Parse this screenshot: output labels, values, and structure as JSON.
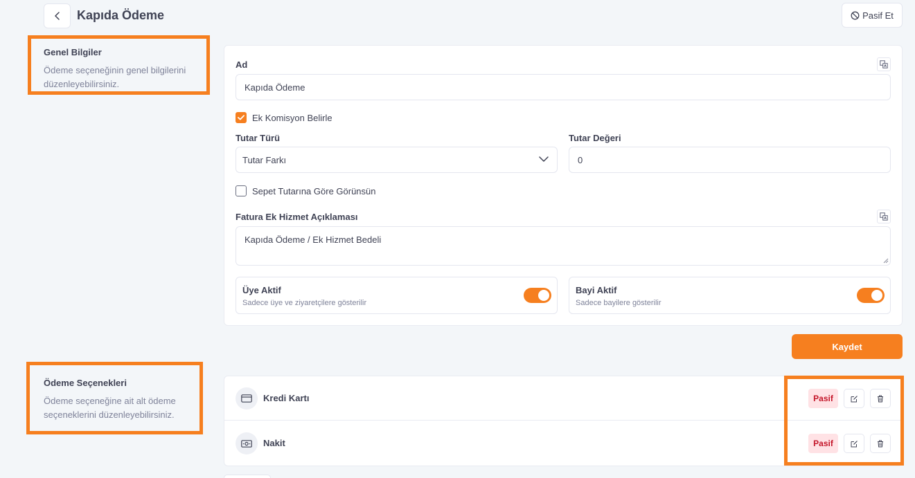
{
  "header": {
    "title": "Kapıda Ödeme",
    "pasif_et_label": "Pasif Et"
  },
  "general_section": {
    "title": "Genel Bilgiler",
    "description": "Ödeme seçeneğinin genel bilgilerini düzenleyebilirsiniz."
  },
  "form": {
    "ad_label": "Ad",
    "ad_value": "Kapıda Ödeme",
    "ek_komisyon_label": "Ek Komisyon Belirle",
    "ek_komisyon_checked": true,
    "tutar_turu_label": "Tutar Türü",
    "tutar_turu_value": "Tutar Farkı",
    "tutar_degeri_label": "Tutar Değeri",
    "tutar_degeri_value": "0",
    "sepet_label": "Sepet Tutarına Göre Görünsün",
    "sepet_checked": false,
    "fatura_label": "Fatura Ek Hizmet Açıklaması",
    "fatura_value": "Kapıda Ödeme / Ek Hizmet Bedeli",
    "uye_aktif": {
      "title": "Üye Aktif",
      "description": "Sadece üye ve ziyaretçilere gösterilir",
      "on": true
    },
    "bayi_aktif": {
      "title": "Bayi Aktif",
      "description": "Sadece bayilere gösterilir",
      "on": true
    },
    "save_label": "Kaydet"
  },
  "options_section": {
    "title": "Ödeme Seçenekleri",
    "description": "Ödeme seçeneğine ait alt ödeme seçeneklerini düzenleyebilirsiniz.",
    "items": [
      {
        "name": "Kredi Kartı",
        "icon": "credit-card-icon",
        "status": "Pasif"
      },
      {
        "name": "Nakit",
        "icon": "cash-icon",
        "status": "Pasif"
      }
    ]
  },
  "colors": {
    "accent": "#f67f1f",
    "badge_bg": "#ffe2e5",
    "badge_text": "#c4162a",
    "page_bg": "#f3f6f9"
  }
}
